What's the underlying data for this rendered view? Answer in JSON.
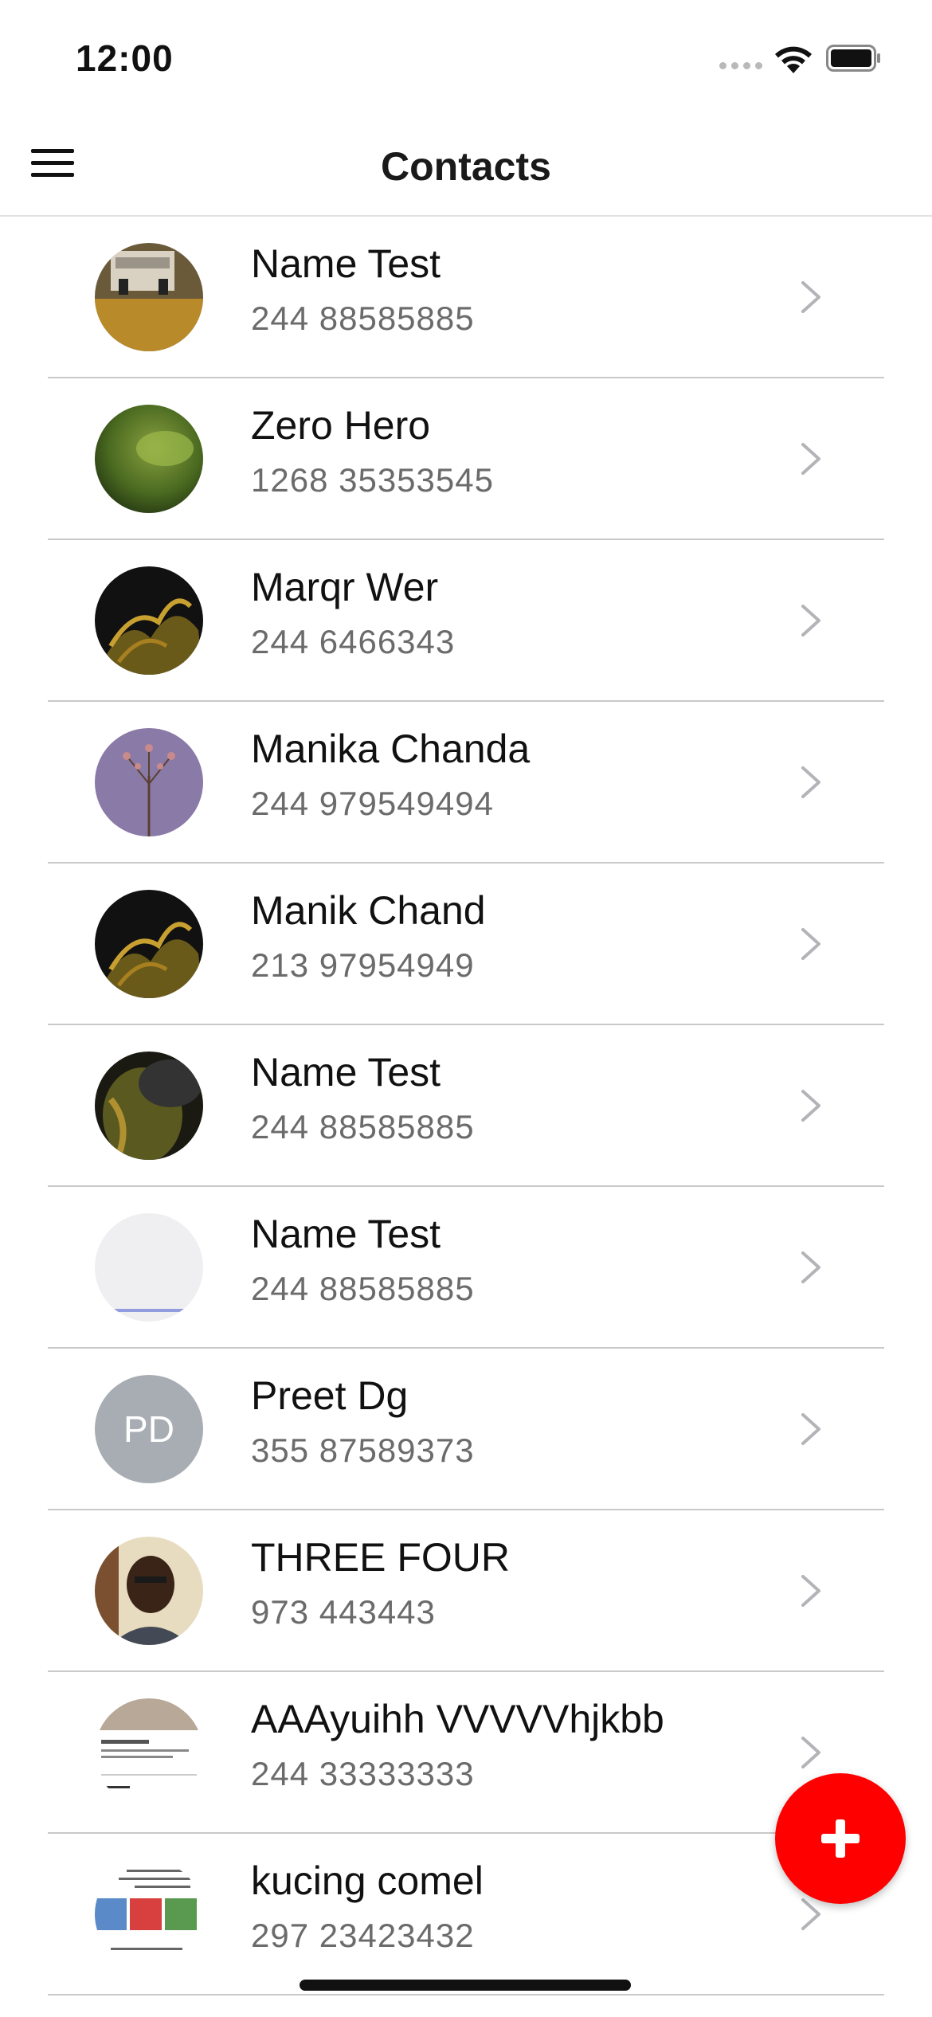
{
  "status_bar": {
    "time": "12:00"
  },
  "nav": {
    "title": "Contacts",
    "menu_icon": "hamburger-menu-icon"
  },
  "contacts": [
    {
      "name": "Name Test",
      "phone": "244 88585885",
      "avatar": "photo"
    },
    {
      "name": "Zero Hero",
      "phone": "1268 35353545",
      "avatar": "photo"
    },
    {
      "name": "Marqr Wer",
      "phone": "244 6466343",
      "avatar": "photo"
    },
    {
      "name": "Manika Chanda",
      "phone": "244 979549494",
      "avatar": "photo"
    },
    {
      "name": "Manik Chand",
      "phone": "213 97954949",
      "avatar": "photo"
    },
    {
      "name": "Name Test",
      "phone": "244 88585885",
      "avatar": "photo"
    },
    {
      "name": "Name Test",
      "phone": "244 88585885",
      "avatar": "photo"
    },
    {
      "name": "Preet Dg",
      "phone": "355 87589373",
      "avatar": "initials",
      "initials": "PD"
    },
    {
      "name": "THREE FOUR",
      "phone": "973 443443",
      "avatar": "photo"
    },
    {
      "name": "AAAyuihh VVVVVhjkbb",
      "phone": "244 33333333",
      "avatar": "photo"
    },
    {
      "name": "kucing comel",
      "phone": "297 23423432",
      "avatar": "photo"
    }
  ],
  "fab": {
    "icon": "plus-icon"
  },
  "colors": {
    "accent": "#ff0000",
    "divider": "#c9c9c9",
    "secondary_text": "#6b6b6b",
    "initials_avatar_bg": "#a8adb3"
  }
}
